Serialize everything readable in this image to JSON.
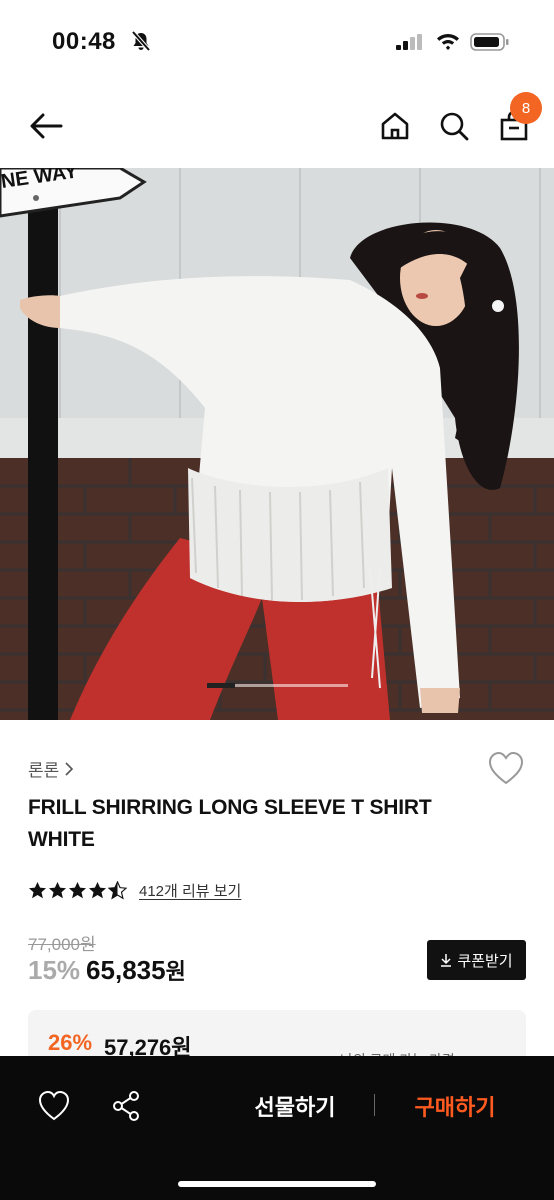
{
  "status_bar": {
    "time": "00:48",
    "icons": [
      "bell-off-icon",
      "signal-icon",
      "wifi-icon",
      "battery-icon"
    ]
  },
  "nav": {
    "icons": [
      "arrow-left-icon",
      "home-icon",
      "search-icon",
      "shopping-bag-icon"
    ],
    "cart_count": "8"
  },
  "hero": {
    "sign_text": "NE WAY",
    "carousel_position": 0.2
  },
  "product": {
    "brand": "론론",
    "title_line1": "FRILL SHIRRING LONG SLEEVE T SHIRT",
    "title_line2": "WHITE",
    "rating": 4.5,
    "review_link": "412개 리뷰 보기",
    "original_price": "77,000원",
    "discount_rate": "15%",
    "sale_price": "65,835",
    "sale_currency": "원",
    "coupon_button": "쿠폰받기"
  },
  "member_price": {
    "rate": "26%",
    "price": "57,276원",
    "note": "나의 구매 가능 가격 >"
  },
  "bottom_bar": {
    "gift_label": "선물하기",
    "buy_label": "구매하기"
  },
  "colors": {
    "accent": "#f26522",
    "buy": "#ff5a1f",
    "bottom_bar": "#0a0a0a"
  }
}
